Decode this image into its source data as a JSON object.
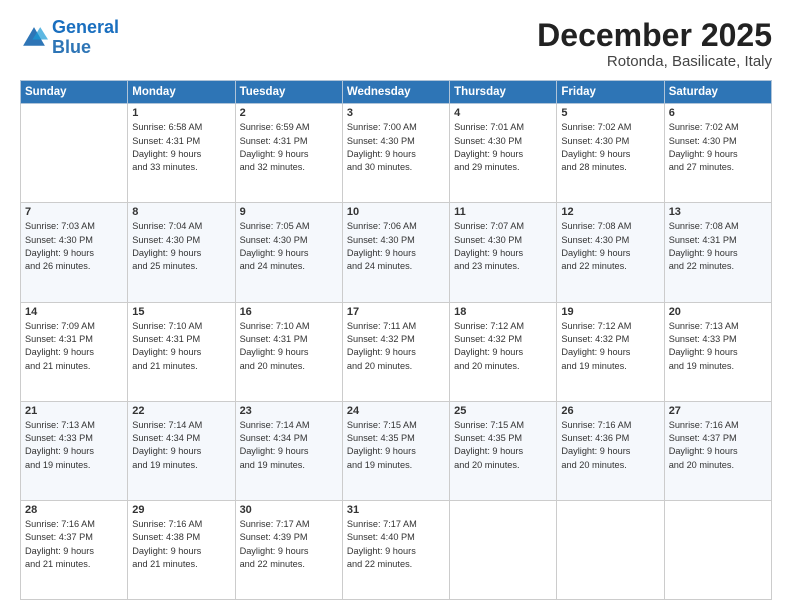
{
  "logo": {
    "line1": "General",
    "line2": "Blue"
  },
  "title": "December 2025",
  "subtitle": "Rotonda, Basilicate, Italy",
  "days_header": [
    "Sunday",
    "Monday",
    "Tuesday",
    "Wednesday",
    "Thursday",
    "Friday",
    "Saturday"
  ],
  "weeks": [
    [
      {
        "day": "",
        "info": ""
      },
      {
        "day": "1",
        "info": "Sunrise: 6:58 AM\nSunset: 4:31 PM\nDaylight: 9 hours\nand 33 minutes."
      },
      {
        "day": "2",
        "info": "Sunrise: 6:59 AM\nSunset: 4:31 PM\nDaylight: 9 hours\nand 32 minutes."
      },
      {
        "day": "3",
        "info": "Sunrise: 7:00 AM\nSunset: 4:30 PM\nDaylight: 9 hours\nand 30 minutes."
      },
      {
        "day": "4",
        "info": "Sunrise: 7:01 AM\nSunset: 4:30 PM\nDaylight: 9 hours\nand 29 minutes."
      },
      {
        "day": "5",
        "info": "Sunrise: 7:02 AM\nSunset: 4:30 PM\nDaylight: 9 hours\nand 28 minutes."
      },
      {
        "day": "6",
        "info": "Sunrise: 7:02 AM\nSunset: 4:30 PM\nDaylight: 9 hours\nand 27 minutes."
      }
    ],
    [
      {
        "day": "7",
        "info": "Sunrise: 7:03 AM\nSunset: 4:30 PM\nDaylight: 9 hours\nand 26 minutes."
      },
      {
        "day": "8",
        "info": "Sunrise: 7:04 AM\nSunset: 4:30 PM\nDaylight: 9 hours\nand 25 minutes."
      },
      {
        "day": "9",
        "info": "Sunrise: 7:05 AM\nSunset: 4:30 PM\nDaylight: 9 hours\nand 24 minutes."
      },
      {
        "day": "10",
        "info": "Sunrise: 7:06 AM\nSunset: 4:30 PM\nDaylight: 9 hours\nand 24 minutes."
      },
      {
        "day": "11",
        "info": "Sunrise: 7:07 AM\nSunset: 4:30 PM\nDaylight: 9 hours\nand 23 minutes."
      },
      {
        "day": "12",
        "info": "Sunrise: 7:08 AM\nSunset: 4:30 PM\nDaylight: 9 hours\nand 22 minutes."
      },
      {
        "day": "13",
        "info": "Sunrise: 7:08 AM\nSunset: 4:31 PM\nDaylight: 9 hours\nand 22 minutes."
      }
    ],
    [
      {
        "day": "14",
        "info": "Sunrise: 7:09 AM\nSunset: 4:31 PM\nDaylight: 9 hours\nand 21 minutes."
      },
      {
        "day": "15",
        "info": "Sunrise: 7:10 AM\nSunset: 4:31 PM\nDaylight: 9 hours\nand 21 minutes."
      },
      {
        "day": "16",
        "info": "Sunrise: 7:10 AM\nSunset: 4:31 PM\nDaylight: 9 hours\nand 20 minutes."
      },
      {
        "day": "17",
        "info": "Sunrise: 7:11 AM\nSunset: 4:32 PM\nDaylight: 9 hours\nand 20 minutes."
      },
      {
        "day": "18",
        "info": "Sunrise: 7:12 AM\nSunset: 4:32 PM\nDaylight: 9 hours\nand 20 minutes."
      },
      {
        "day": "19",
        "info": "Sunrise: 7:12 AM\nSunset: 4:32 PM\nDaylight: 9 hours\nand 19 minutes."
      },
      {
        "day": "20",
        "info": "Sunrise: 7:13 AM\nSunset: 4:33 PM\nDaylight: 9 hours\nand 19 minutes."
      }
    ],
    [
      {
        "day": "21",
        "info": "Sunrise: 7:13 AM\nSunset: 4:33 PM\nDaylight: 9 hours\nand 19 minutes."
      },
      {
        "day": "22",
        "info": "Sunrise: 7:14 AM\nSunset: 4:34 PM\nDaylight: 9 hours\nand 19 minutes."
      },
      {
        "day": "23",
        "info": "Sunrise: 7:14 AM\nSunset: 4:34 PM\nDaylight: 9 hours\nand 19 minutes."
      },
      {
        "day": "24",
        "info": "Sunrise: 7:15 AM\nSunset: 4:35 PM\nDaylight: 9 hours\nand 19 minutes."
      },
      {
        "day": "25",
        "info": "Sunrise: 7:15 AM\nSunset: 4:35 PM\nDaylight: 9 hours\nand 20 minutes."
      },
      {
        "day": "26",
        "info": "Sunrise: 7:16 AM\nSunset: 4:36 PM\nDaylight: 9 hours\nand 20 minutes."
      },
      {
        "day": "27",
        "info": "Sunrise: 7:16 AM\nSunset: 4:37 PM\nDaylight: 9 hours\nand 20 minutes."
      }
    ],
    [
      {
        "day": "28",
        "info": "Sunrise: 7:16 AM\nSunset: 4:37 PM\nDaylight: 9 hours\nand 21 minutes."
      },
      {
        "day": "29",
        "info": "Sunrise: 7:16 AM\nSunset: 4:38 PM\nDaylight: 9 hours\nand 21 minutes."
      },
      {
        "day": "30",
        "info": "Sunrise: 7:17 AM\nSunset: 4:39 PM\nDaylight: 9 hours\nand 22 minutes."
      },
      {
        "day": "31",
        "info": "Sunrise: 7:17 AM\nSunset: 4:40 PM\nDaylight: 9 hours\nand 22 minutes."
      },
      {
        "day": "",
        "info": ""
      },
      {
        "day": "",
        "info": ""
      },
      {
        "day": "",
        "info": ""
      }
    ]
  ]
}
